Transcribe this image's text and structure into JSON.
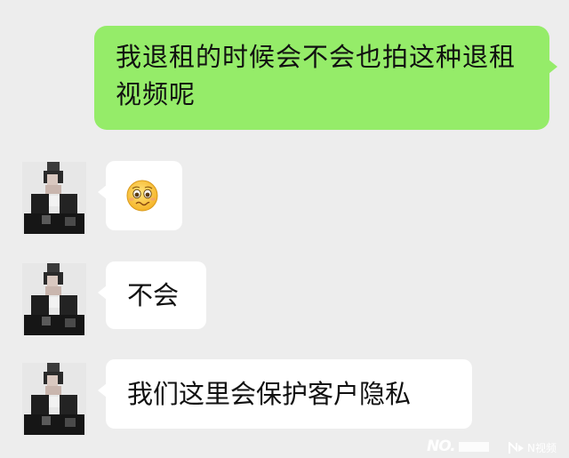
{
  "chat": {
    "messages": [
      {
        "sender": "me",
        "type": "text",
        "text": "我退租的时候会不会也拍这种退租视频呢"
      },
      {
        "sender": "other",
        "type": "emoji",
        "emoji": "woozy-face-emoji"
      },
      {
        "sender": "other",
        "type": "text",
        "text": "不会"
      },
      {
        "sender": "other",
        "type": "text",
        "text": "我们这里会保护客户隐私"
      }
    ]
  },
  "watermark": {
    "left_text": "NO.",
    "right_text": "N视频"
  },
  "colors": {
    "background": "#ededed",
    "sent_bubble": "#95ec69",
    "received_bubble": "#ffffff"
  }
}
